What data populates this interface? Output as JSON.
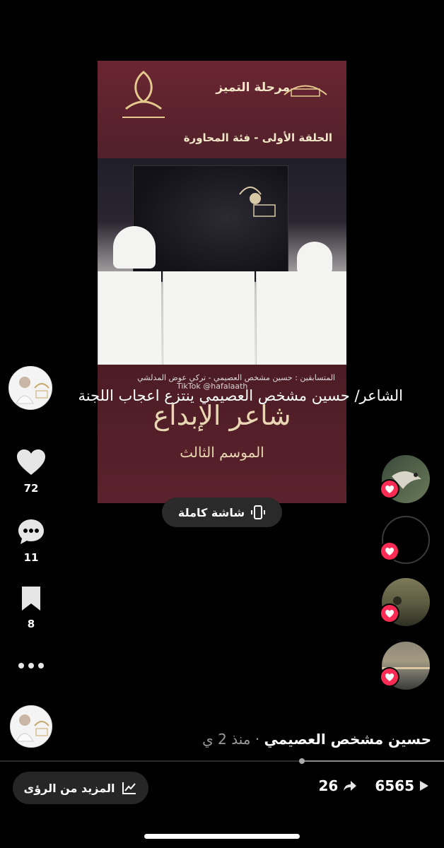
{
  "video": {
    "stage_title": "مرحلة التميز",
    "episode": "الحلقة الأولى - فئة المحاورة",
    "names_line": "المتسابقين : حسين مشخص العصيمي - تركي عوض المدلشي",
    "brand_title": "شاعر الإبداع",
    "season": "الموسم الثالث",
    "watermark": "TikTok @hafalaath"
  },
  "caption": "الشاعر/ حسين مشخص العصيمي ينتزع اعجاب اللجنة",
  "fullscreen_label": "شاشة كاملة",
  "rail": {
    "likes": "72",
    "comments": "11",
    "saves": "8"
  },
  "author": {
    "name": "حسين مشخص العصيمي",
    "time": "· منذ 2 ي"
  },
  "progress_fraction": 0.32,
  "insights_label": "المزيد من الرؤى",
  "stats": {
    "views": "6565",
    "shares": "26"
  },
  "colors": {
    "accent": "#fe2c55",
    "video_maroon": "#5a1f2a"
  }
}
